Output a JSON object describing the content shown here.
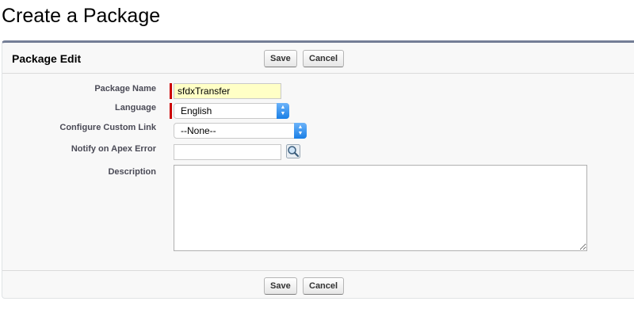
{
  "page": {
    "title": "Create a Package"
  },
  "panel": {
    "title": "Package Edit",
    "save_label": "Save",
    "cancel_label": "Cancel"
  },
  "form": {
    "package_name": {
      "label": "Package Name",
      "value": "sfdxTransfer",
      "required": true
    },
    "language": {
      "label": "Language",
      "value": "English",
      "required": true
    },
    "custom_link": {
      "label": "Configure Custom Link",
      "value": "--None--"
    },
    "apex_error": {
      "label": "Notify on Apex Error",
      "value": "",
      "icon": "lookup-icon"
    },
    "description": {
      "label": "Description",
      "value": ""
    }
  },
  "colors": {
    "header_border": "#747e96",
    "required": "#cc0000",
    "highlight_input": "#ffffc6",
    "select_accent": "#1a7fe6"
  }
}
